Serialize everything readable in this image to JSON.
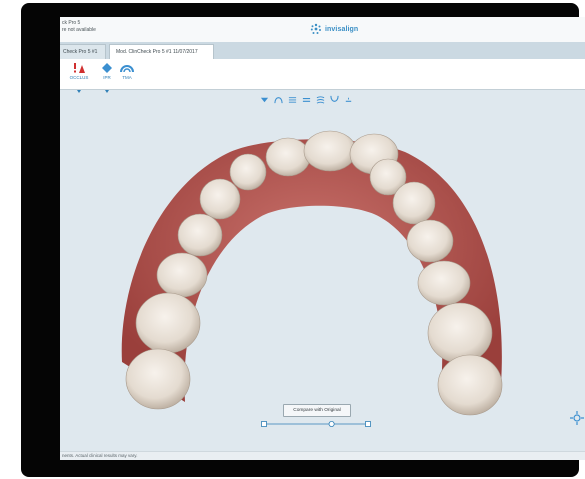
{
  "window": {
    "title_line1": "ck Pro 5",
    "title_line2": "re not available",
    "brand": "invisalign"
  },
  "tabs": [
    {
      "label": "Check Pro 5 #1"
    },
    {
      "label": "Mod. ClinCheck Pro 5 #1 11/07/2017"
    }
  ],
  "ribbon": {
    "buttons": [
      {
        "label": "OCCLUS",
        "icon": "occlusion-icon"
      },
      {
        "label": "IPR",
        "icon": "ipr-icon"
      },
      {
        "label": "TMA",
        "icon": "tma-icon"
      }
    ]
  },
  "viewer": {
    "view_tools": [
      "view-front-icon",
      "arch-icon",
      "layers-icon",
      "grid-icon",
      "superimpose-icon",
      "lower-jaw-icon",
      "minus-icon"
    ],
    "compare_button": "Compare with Original",
    "stage_slider": {
      "value": 0.65
    },
    "colors": {
      "gum": "#b85a55",
      "tooth": "#e8e0d6",
      "background": "#dfe8ee",
      "accent": "#2f7fb6"
    }
  },
  "status_bar": {
    "text": "nents. Actual clinical results may vary."
  }
}
